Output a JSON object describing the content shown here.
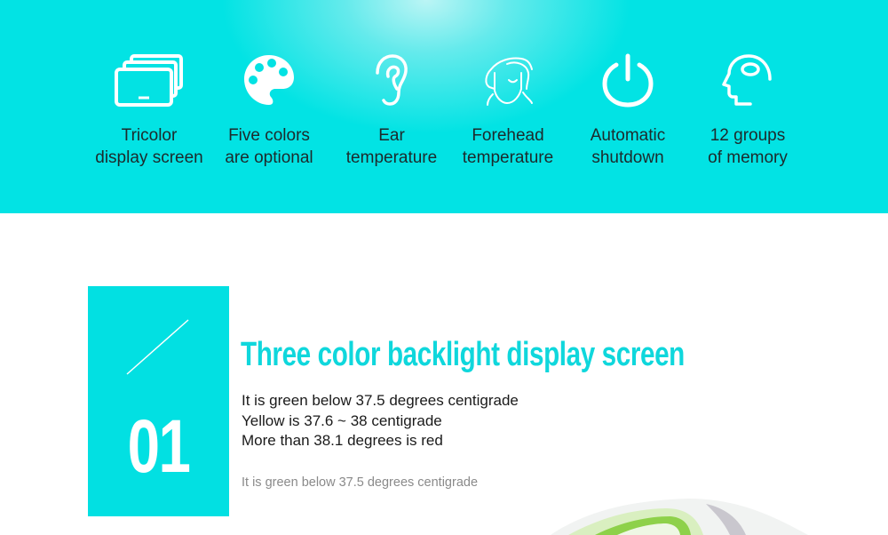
{
  "features": [
    {
      "icon": "tablet-stack-icon",
      "line1": "Tricolor",
      "line2": "display screen"
    },
    {
      "icon": "palette-icon",
      "line1": "Five colors",
      "line2": "are optional"
    },
    {
      "icon": "ear-icon",
      "line1": "Ear",
      "line2": "temperature"
    },
    {
      "icon": "forehead-face-icon",
      "line1": "Forehead",
      "line2": "temperature"
    },
    {
      "icon": "power-icon",
      "line1": "Automatic",
      "line2": "shutdown"
    },
    {
      "icon": "head-memory-icon",
      "line1": "12 groups",
      "line2": "of memory"
    }
  ],
  "section": {
    "number": "01",
    "title": "Three color backlight display screen",
    "lines": [
      "It is green below 37.5 degrees centigrade",
      "Yellow is 37.6 ~ 38 centigrade",
      "More than 38.1 degrees is red"
    ],
    "note": "It is green below 37.5 degrees centigrade"
  },
  "colors": {
    "accent": "#02e3e4",
    "title": "#0fd7dc"
  }
}
